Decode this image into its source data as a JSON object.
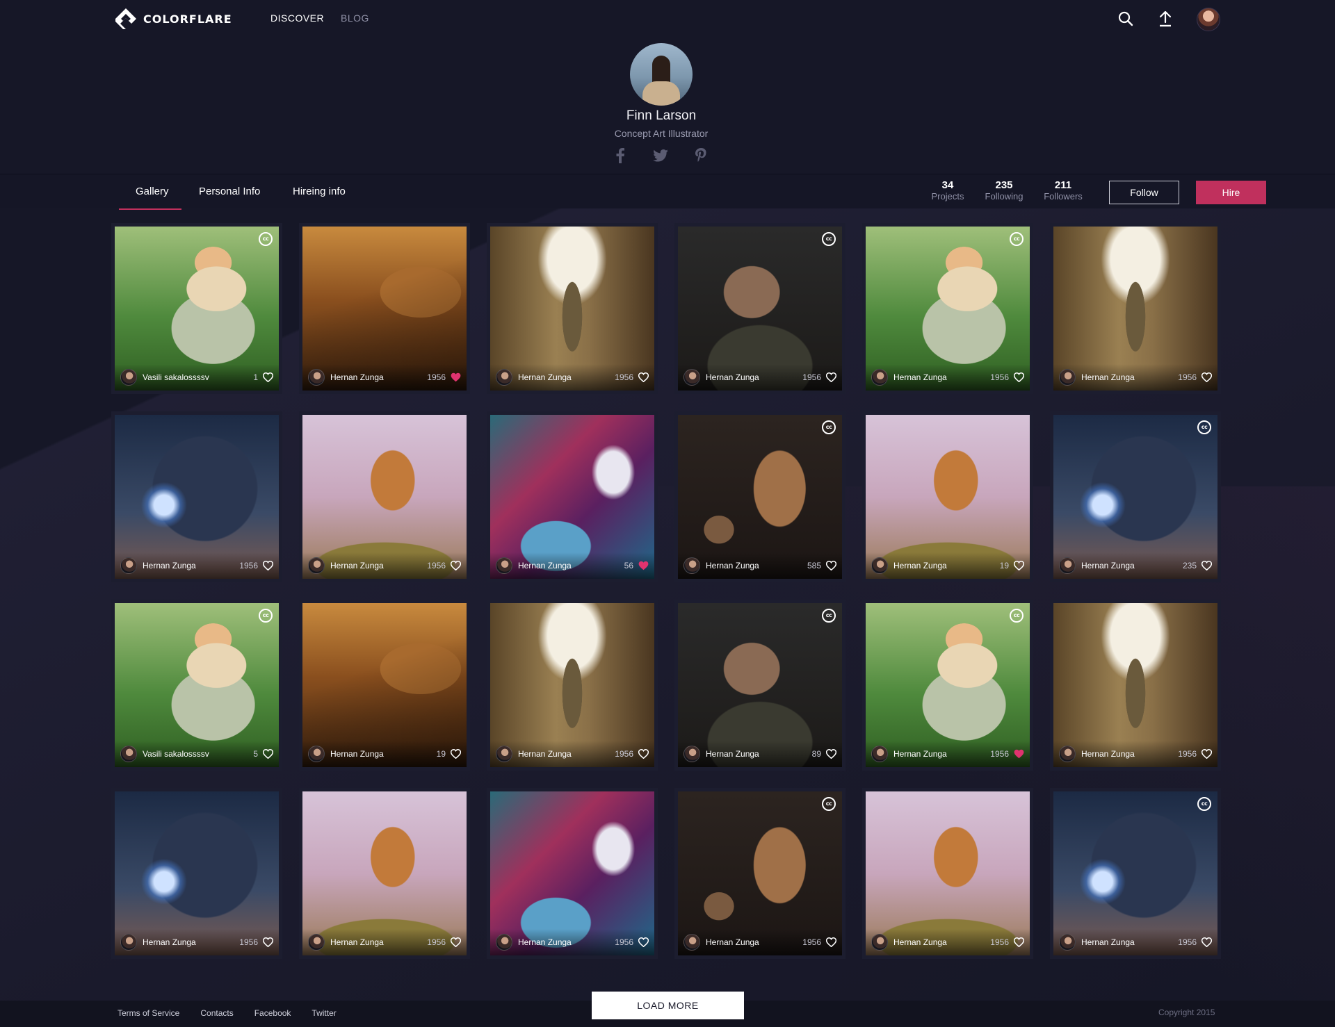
{
  "brand": {
    "name": "COLORFLARE"
  },
  "topnav": {
    "links": [
      "DISCOVER",
      "BLOG"
    ],
    "icons": [
      "search-icon",
      "upload-icon"
    ]
  },
  "profile": {
    "name": "Finn Larson",
    "role": "Concept Art Illustrator",
    "social": [
      "facebook-icon",
      "twitter-icon",
      "pinterest-icon"
    ]
  },
  "tabs": [
    "Gallery",
    "Personal Info",
    "Hireing info"
  ],
  "active_tab": "Gallery",
  "stats": [
    {
      "num": "34",
      "label": "Projects"
    },
    {
      "num": "235",
      "label": "Following"
    },
    {
      "num": "211",
      "label": "Followers"
    }
  ],
  "actions": {
    "follow": "Follow",
    "hire": "Hire"
  },
  "colors": {
    "accent": "#c0305d",
    "background": "#161727",
    "heart_liked": "#e0336f"
  },
  "gallery": [
    {
      "art": "boy",
      "author": "Vasili sakalossssv",
      "count": "1",
      "liked": false,
      "cc": true
    },
    {
      "art": "city",
      "author": "Hernan Zunga",
      "count": "1956",
      "liked": true,
      "cc": false
    },
    {
      "art": "robot",
      "author": "Hernan Zunga",
      "count": "1956",
      "liked": false,
      "cc": false
    },
    {
      "art": "punk",
      "author": "Hernan Zunga",
      "count": "1956",
      "liked": false,
      "cc": true
    },
    {
      "art": "boy",
      "author": "Hernan Zunga",
      "count": "1956",
      "liked": false,
      "cc": true
    },
    {
      "art": "robot",
      "author": "Hernan Zunga",
      "count": "1956",
      "liked": false,
      "cc": false
    },
    {
      "art": "mech",
      "author": "Hernan Zunga",
      "count": "1956",
      "liked": false,
      "cc": false
    },
    {
      "art": "tree",
      "author": "Hernan Zunga",
      "count": "1956",
      "liked": false,
      "cc": false
    },
    {
      "art": "bird",
      "author": "Hernan Zunga",
      "count": "56",
      "liked": true,
      "cc": false
    },
    {
      "art": "groot",
      "author": "Hernan Zunga",
      "count": "585",
      "liked": false,
      "cc": true
    },
    {
      "art": "tree",
      "author": "Hernan Zunga",
      "count": "19",
      "liked": false,
      "cc": false
    },
    {
      "art": "mech",
      "author": "Hernan Zunga",
      "count": "235",
      "liked": false,
      "cc": true
    },
    {
      "art": "boy",
      "author": "Vasili sakalossssv",
      "count": "5",
      "liked": false,
      "cc": true
    },
    {
      "art": "city",
      "author": "Hernan Zunga",
      "count": "19",
      "liked": false,
      "cc": false
    },
    {
      "art": "robot",
      "author": "Hernan Zunga",
      "count": "1956",
      "liked": false,
      "cc": false
    },
    {
      "art": "punk",
      "author": "Hernan Zunga",
      "count": "89",
      "liked": false,
      "cc": true
    },
    {
      "art": "boy",
      "author": "Hernan Zunga",
      "count": "1956",
      "liked": true,
      "cc": true
    },
    {
      "art": "robot",
      "author": "Hernan Zunga",
      "count": "1956",
      "liked": false,
      "cc": false
    },
    {
      "art": "mech",
      "author": "Hernan Zunga",
      "count": "1956",
      "liked": false,
      "cc": false
    },
    {
      "art": "tree",
      "author": "Hernan Zunga",
      "count": "1956",
      "liked": false,
      "cc": false
    },
    {
      "art": "bird",
      "author": "Hernan Zunga",
      "count": "1956",
      "liked": false,
      "cc": false
    },
    {
      "art": "groot",
      "author": "Hernan Zunga",
      "count": "1956",
      "liked": false,
      "cc": true
    },
    {
      "art": "tree",
      "author": "Hernan Zunga",
      "count": "1956",
      "liked": false,
      "cc": false
    },
    {
      "art": "mech",
      "author": "Hernan Zunga",
      "count": "1956",
      "liked": false,
      "cc": true
    }
  ],
  "cc_label": "cc",
  "load_more": "LOAD MORE",
  "footer": {
    "links": [
      "Terms of Service",
      "Contacts",
      "Facebook",
      "Twitter"
    ],
    "copyright": "Copyright 2015"
  }
}
